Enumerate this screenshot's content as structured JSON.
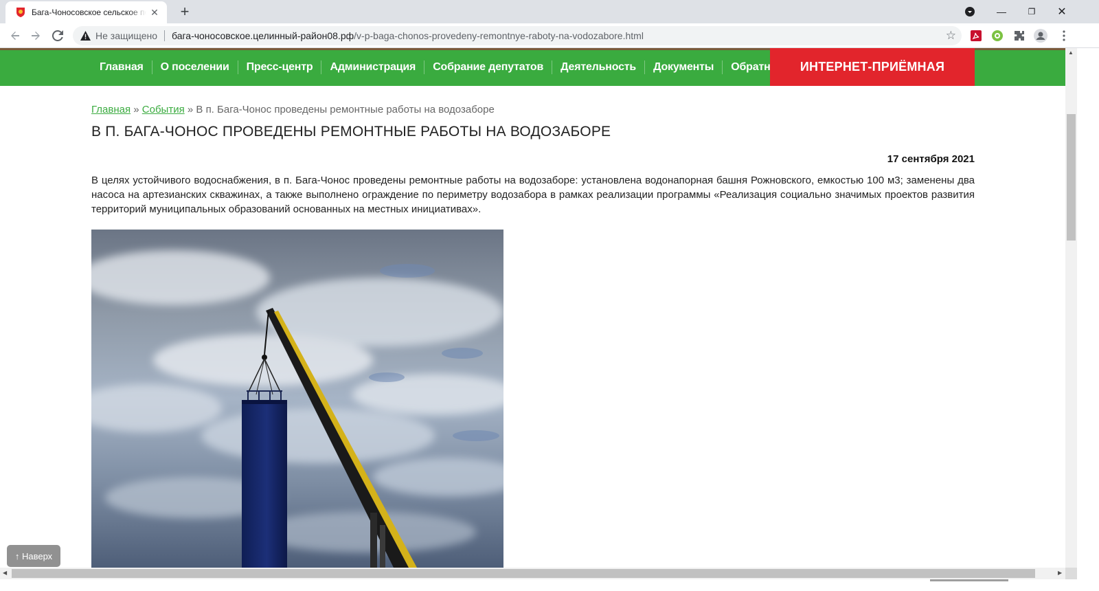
{
  "browser": {
    "tab_title": "Бага-Чоносовское сельское поселение",
    "security_label": "Не защищено",
    "url_host": "бага-чоносовское.целинный-район08.рф",
    "url_path": "/v-p-baga-chonos-provedeny-remontnye-raboty-na-vodozabore.html",
    "icons": [
      "favicon-emblem-icon",
      "close-icon",
      "plus-icon",
      "back-icon",
      "forward-icon",
      "reload-icon",
      "warning-icon",
      "star-icon",
      "pdf-extension-icon",
      "green-extension-icon",
      "puzzle-extensions-icon",
      "profile-avatar-icon",
      "more-menu-icon"
    ]
  },
  "nav": {
    "items": [
      "Главная",
      "О поселении",
      "Пресс-центр",
      "Администрация",
      "Собрание депутатов",
      "Деятельность",
      "Документы",
      "Обратная связь"
    ],
    "reception": "ИНТЕРНЕТ-ПРИЁМНАЯ"
  },
  "breadcrumb": {
    "home": "Главная",
    "sep1": " » ",
    "section": "События",
    "sep2": " » ",
    "current": "В п. Бага-Чонос проведены ремонтные работы на водозаборе"
  },
  "article": {
    "title": "В П. БАГА-ЧОНОС ПРОВЕДЕНЫ РЕМОНТНЫЕ РАБОТЫ НА ВОДОЗАБОРЕ",
    "date": "17 сентября 2021",
    "body": "В целях устойчивого водоснабжения, в п. Бага-Чонос проведены ремонтные работы на водозаборе: установлена водонапорная башня Рожновского, емкостью 100 м3; заменены два насоса на артезианских скважинах, а также выполнено ограждение по периметру водозабора в рамках реализации программы «Реализация социально значимых проектов развития территорий муниципальных образований основанных на местных инициативах»."
  },
  "to_top": "↑ Наверх",
  "colors": {
    "nav_green": "#3aab3f",
    "reception_red": "#e2252c",
    "link_green": "#3aab3f"
  }
}
